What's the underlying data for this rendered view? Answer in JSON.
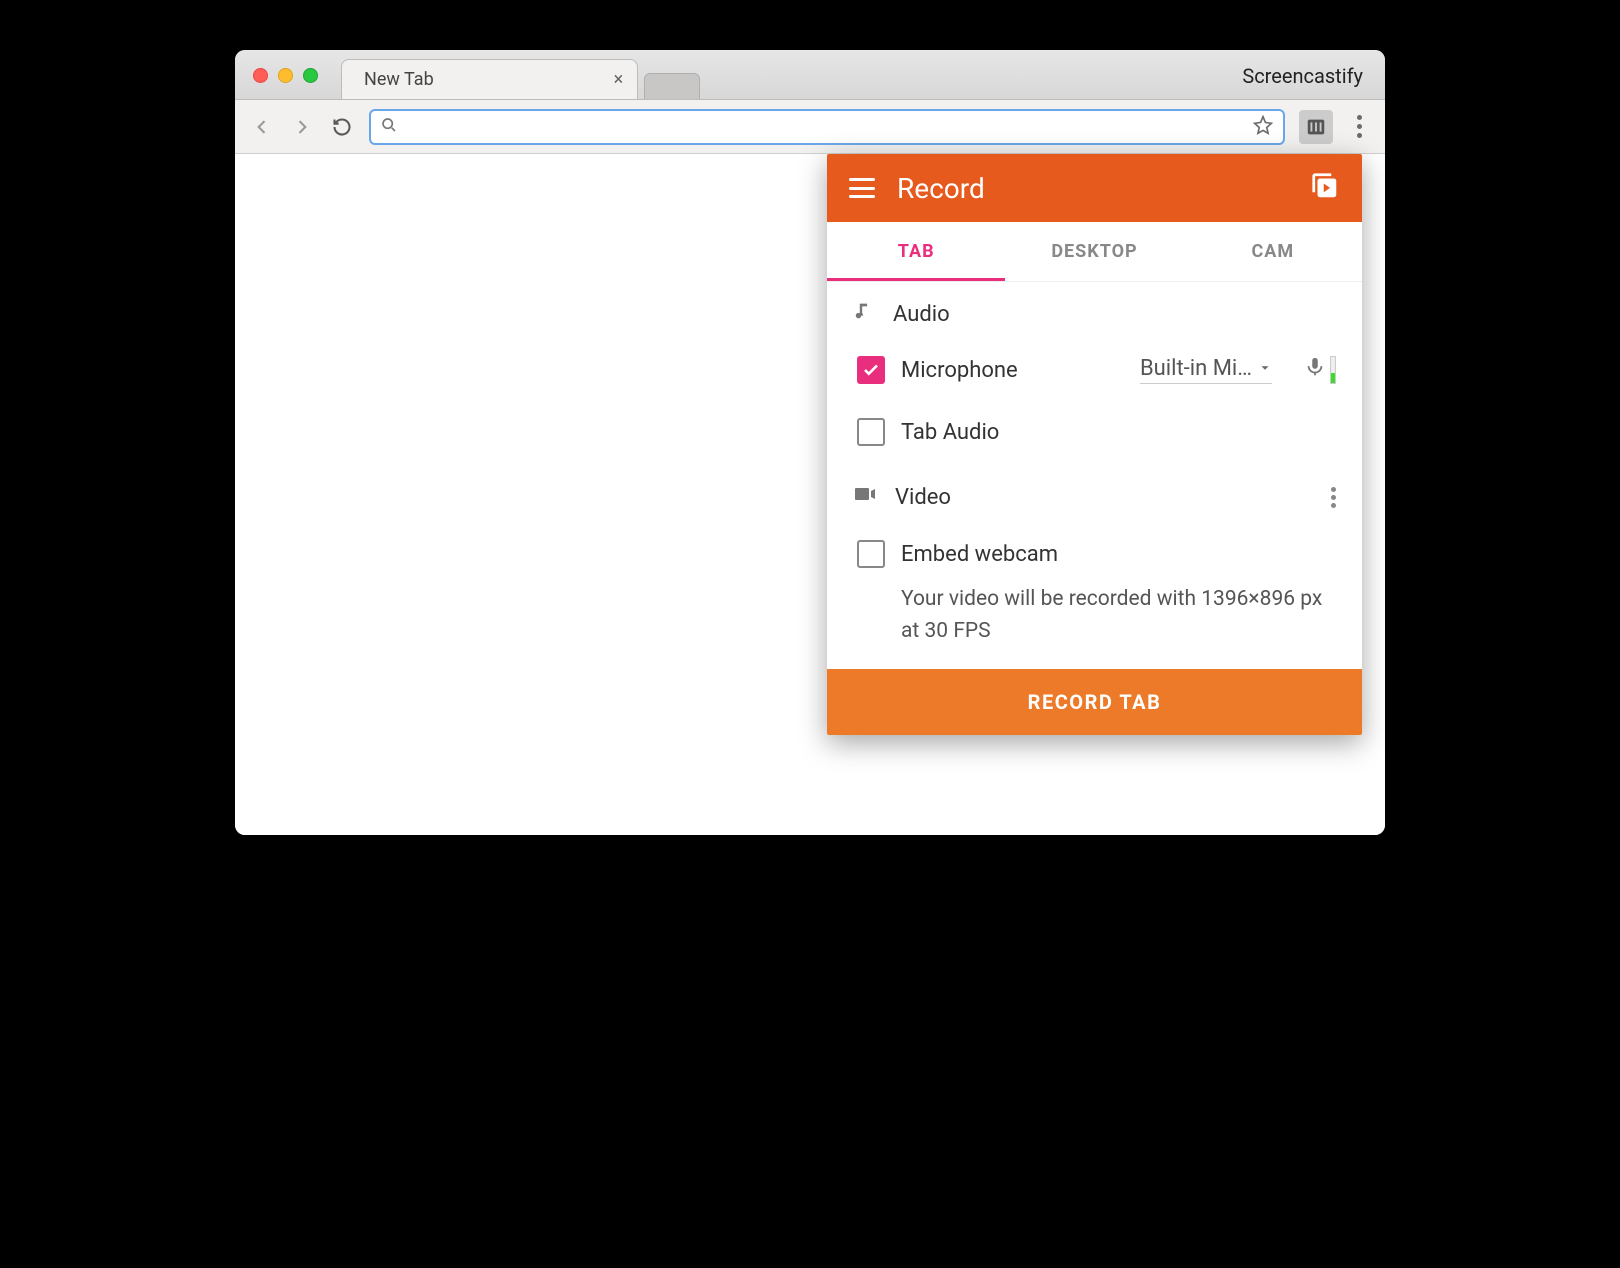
{
  "browser": {
    "tab_title": "New Tab",
    "extension_label": "Screencastify"
  },
  "popup": {
    "header_title": "Record",
    "tabs": {
      "tab": "TAB",
      "desktop": "DESKTOP",
      "cam": "CAM"
    },
    "audio": {
      "section_label": "Audio",
      "microphone_label": "Microphone",
      "microphone_device": "Built-in Mi…",
      "tab_audio_label": "Tab Audio"
    },
    "video": {
      "section_label": "Video",
      "embed_webcam_label": "Embed webcam",
      "info_text": "Your video will be recorded with 1396×896 px at 30 FPS"
    },
    "record_button_label": "RECORD TAB"
  },
  "colors": {
    "accent_orange": "#e65a1e",
    "accent_pink": "#ea2e7e",
    "button_orange": "#ec7a29"
  }
}
